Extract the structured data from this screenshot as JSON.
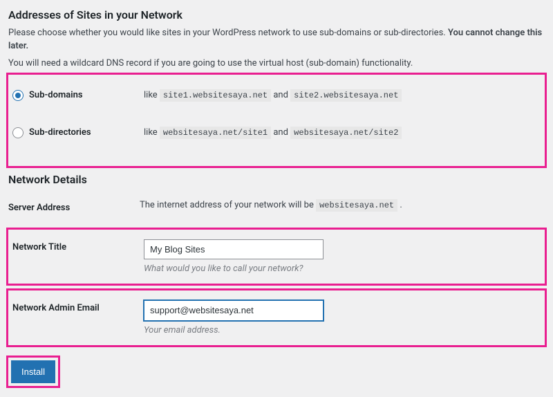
{
  "addresses": {
    "heading": "Addresses of Sites in your Network",
    "desc_prefix": "Please choose whether you would like sites in your WordPress network to use sub-domains or sub-directories. ",
    "desc_bold": "You cannot change this later.",
    "dns_note": "You will need a wildcard DNS record if you are going to use the virtual host (sub-domain) functionality.",
    "subdomains": {
      "label": "Sub-domains",
      "like": "like ",
      "ex1": "site1.websitesaya.net",
      "and": " and ",
      "ex2": "site2.websitesaya.net"
    },
    "subdirectories": {
      "label": "Sub-directories",
      "like": "like ",
      "ex1": "websitesaya.net/site1",
      "and": " and ",
      "ex2": "websitesaya.net/site2"
    }
  },
  "details": {
    "heading": "Network Details",
    "server_address": {
      "label": "Server Address",
      "text_prefix": "The internet address of your network will be ",
      "domain": "websitesaya.net",
      "text_suffix": " ."
    },
    "network_title": {
      "label": "Network Title",
      "value": "My Blog Sites",
      "hint": "What would you like to call your network?"
    },
    "admin_email": {
      "label": "Network Admin Email",
      "value": "support@websitesaya.net",
      "hint": "Your email address."
    }
  },
  "submit": {
    "install": "Install"
  }
}
